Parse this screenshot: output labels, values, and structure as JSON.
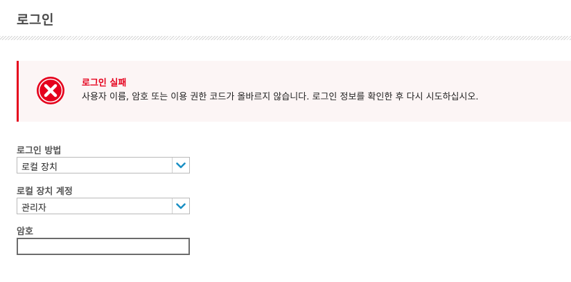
{
  "page": {
    "title": "로그인"
  },
  "alert": {
    "icon": "error-x-icon",
    "title": "로그인 실패",
    "message": "사용자 이름, 암호 또는 이용 권한 코드가 올바르지 않습니다. 로그인 정보를 확인한 후 다시 시도하십시오.",
    "accent_color": "#e5001c",
    "background_color": "#fcf5f5"
  },
  "form": {
    "login_method": {
      "label": "로그인 방법",
      "selected": "로컬 장치"
    },
    "local_account": {
      "label": "로컬 장치 계정",
      "selected": "관리자"
    },
    "password": {
      "label": "암호",
      "value": ""
    }
  },
  "colors": {
    "dropdown_chevron": "#1a8fc4"
  }
}
